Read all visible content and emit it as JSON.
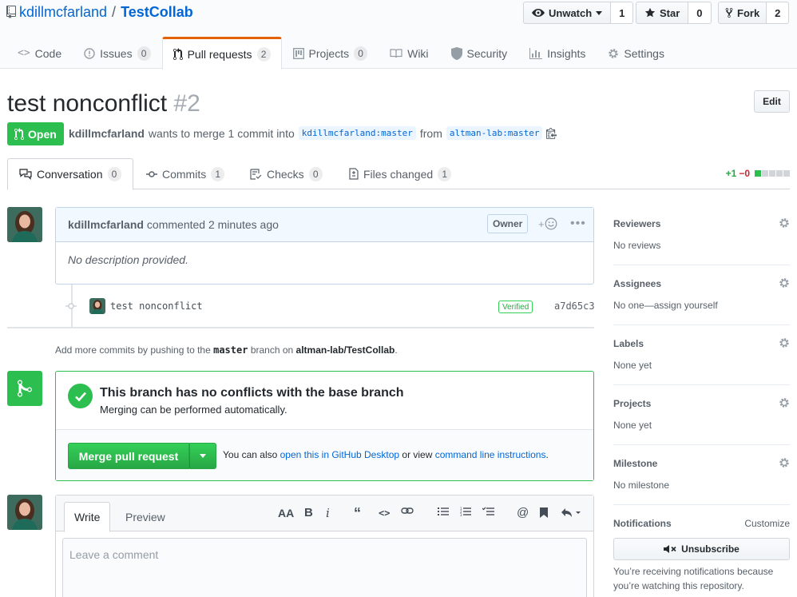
{
  "repo": {
    "owner": "kdillmcfarland",
    "separator": "/",
    "name": "TestCollab"
  },
  "actions": {
    "watch": {
      "label": "Unwatch",
      "count": "1"
    },
    "star": {
      "label": "Star",
      "count": "0"
    },
    "fork": {
      "label": "Fork",
      "count": "2"
    }
  },
  "nav": [
    {
      "label": "Code",
      "icon": "code-icon",
      "count": ""
    },
    {
      "label": "Issues",
      "icon": "issue-icon",
      "count": "0"
    },
    {
      "label": "Pull requests",
      "icon": "pull-request-icon",
      "count": "2"
    },
    {
      "label": "Projects",
      "icon": "project-icon",
      "count": "0"
    },
    {
      "label": "Wiki",
      "icon": "book-icon",
      "count": ""
    },
    {
      "label": "Security",
      "icon": "shield-icon",
      "count": ""
    },
    {
      "label": "Insights",
      "icon": "graph-icon",
      "count": ""
    },
    {
      "label": "Settings",
      "icon": "gear-icon",
      "count": ""
    }
  ],
  "pr": {
    "title": "test nonconflict",
    "number": "#2",
    "edit_label": "Edit",
    "state": "Open",
    "author": "kdillmcfarland",
    "meta_text": "wants to merge 1 commit into",
    "base_branch": "kdillmcfarland:master",
    "from_text": "from",
    "head_branch": "altman-lab:master"
  },
  "tabs": [
    {
      "label": "Conversation",
      "count": "0",
      "icon": "comment-discussion-icon"
    },
    {
      "label": "Commits",
      "count": "1",
      "icon": "commit-icon"
    },
    {
      "label": "Checks",
      "count": "0",
      "icon": "checklist-icon"
    },
    {
      "label": "Files changed",
      "count": "1",
      "icon": "file-diff-icon"
    }
  ],
  "diffstat": {
    "additions": "+1",
    "deletions": "−0"
  },
  "comment": {
    "author": "kdillmcfarland",
    "action": "commented 2 minutes ago",
    "badge": "Owner",
    "body": "No description provided."
  },
  "commit": {
    "message": "test nonconflict",
    "verified": "Verified",
    "sha": "a7d65c3"
  },
  "hint": {
    "prefix": "Add more commits by pushing to the",
    "branch": "master",
    "middle": "branch on",
    "repo": "altman-lab/TestCollab",
    "suffix": "."
  },
  "merge": {
    "heading": "This branch has no conflicts with the base branch",
    "sub": "Merging can be performed automatically.",
    "button": "Merge pull request",
    "alt_prefix": "You can also",
    "alt_link1": "open this in GitHub Desktop",
    "alt_middle": "or view",
    "alt_link2": "command line instructions",
    "alt_suffix": "."
  },
  "composer": {
    "write_tab": "Write",
    "preview_tab": "Preview",
    "placeholder": "Leave a comment"
  },
  "sidebar": {
    "reviewers": {
      "heading": "Reviewers",
      "value": "No reviews"
    },
    "assignees": {
      "heading": "Assignees",
      "value": "No one—assign yourself"
    },
    "labels": {
      "heading": "Labels",
      "value": "None yet"
    },
    "projects": {
      "heading": "Projects",
      "value": "None yet"
    },
    "milestone": {
      "heading": "Milestone",
      "value": "No milestone"
    },
    "notifications": {
      "heading": "Notifications",
      "customize": "Customize",
      "button": "Unsubscribe",
      "text": "You’re receiving notifications because you’re watching this repository."
    }
  },
  "colors": {
    "green": "#2cbe4e",
    "blue": "#0366d6",
    "orange": "#e36209",
    "red": "#cb2431"
  }
}
